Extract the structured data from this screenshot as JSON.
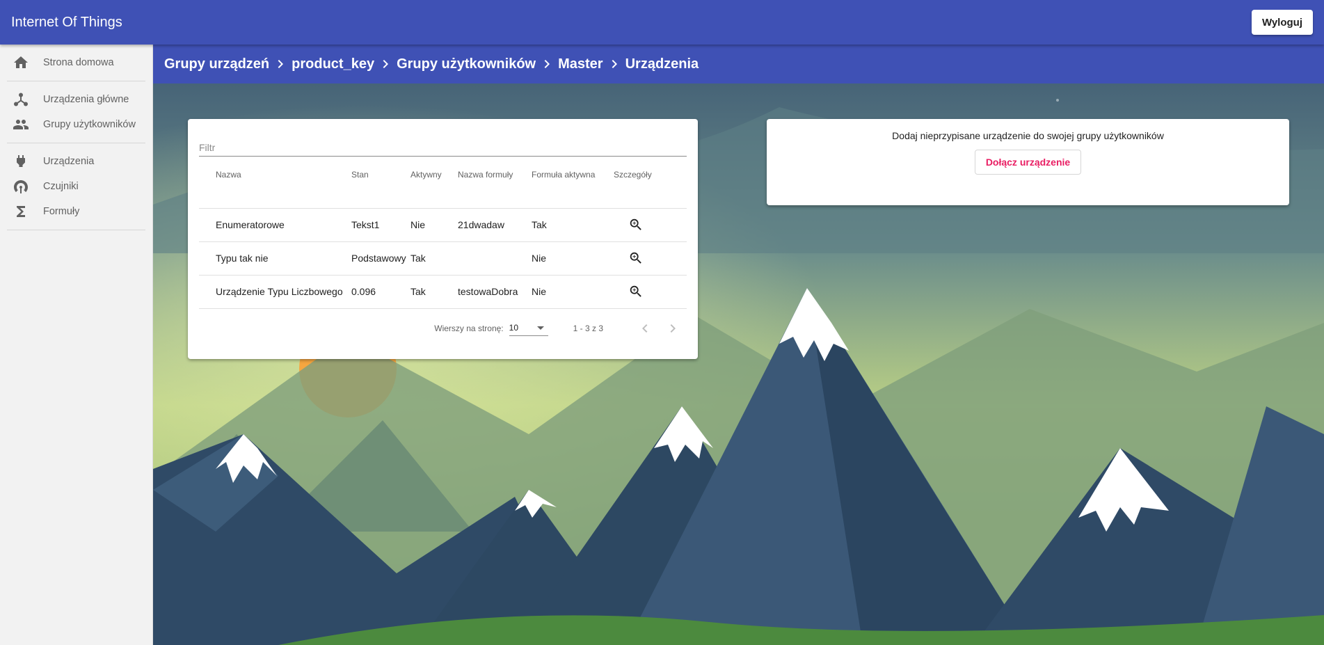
{
  "header": {
    "title": "Internet Of Things",
    "logout_label": "Wyloguj"
  },
  "sidebar": {
    "groups": [
      [
        {
          "label": "Strona domowa",
          "icon": "home-icon"
        }
      ],
      [
        {
          "label": "Urządzenia główne",
          "icon": "hub-icon"
        },
        {
          "label": "Grupy użytkowników",
          "icon": "people-icon"
        }
      ],
      [
        {
          "label": "Urządzenia",
          "icon": "plug-icon"
        },
        {
          "label": "Czujniki",
          "icon": "antenna-icon"
        },
        {
          "label": "Formuły",
          "icon": "sigma-icon"
        }
      ]
    ]
  },
  "breadcrumb": [
    "Grupy urządzeń",
    "product_key",
    "Grupy użytkowników",
    "Master",
    "Urządzenia"
  ],
  "table": {
    "filter_placeholder": "Filtr",
    "columns": [
      "Nazwa",
      "Stan",
      "Aktywny",
      "Nazwa formuły",
      "Formuła aktywna",
      "Szczegóły"
    ],
    "rows": [
      [
        "Enumeratorowe",
        "Tekst1",
        "Nie",
        "21dwadaw",
        "Tak"
      ],
      [
        "Typu tak nie",
        "Podstawowy",
        "Tak",
        "",
        "Nie"
      ],
      [
        "Urządzenie Typu Liczbowego",
        "0.096",
        "Tak",
        "testowaDobra",
        "Nie"
      ]
    ],
    "paginator": {
      "rows_per_page_label": "Wierszy na stronę:",
      "page_size": "10",
      "range_label": "1 - 3 z 3"
    }
  },
  "add_device": {
    "text": "Dodaj nieprzypisane urządzenie do swojej grupy użytkowników",
    "button_label": "Dołącz urządzenie"
  },
  "colors": {
    "primary": "#3f51b5",
    "accent": "#e91e63"
  }
}
